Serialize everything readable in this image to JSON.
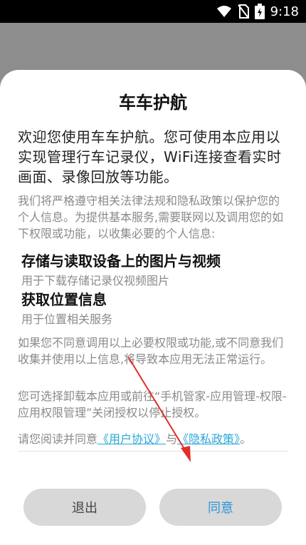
{
  "status_bar": {
    "time": "9:18",
    "icons": [
      "wifi-icon",
      "no-sim-icon",
      "battery-charging-icon"
    ]
  },
  "dialog": {
    "title": "车车护航",
    "intro": "欢迎您使用车车护航。您可使用本应用以实现管理行车记录仪，WiFi连接查看实时画面、录像回放等功能。",
    "notice": "我们将严格遵守相关法律法规和隐私政策以保护您的个人信息。为提供基本服务,需要联网以及调用您的如下权限或功能，以收集必要的个人信息:",
    "permissions": [
      {
        "title": "存储与读取设备上的图片与视频",
        "desc": "用于下载存储记录仪视频图片"
      },
      {
        "title": "获取位置信息",
        "desc": "用于位置相关服务"
      }
    ],
    "disagree_text": "如果您不同意调用以上必要权限或功能,或不同意我们收集并使用以上信息,将导致本应用无法正常运行。",
    "revoke_text": "您可选择卸载本应用或前往“手机管家-应用管理-权限-应用权限管理”关闭授权以停止授权。",
    "agreement": {
      "prefix": "请您阅读并同意",
      "user_agreement_link": "《用户协议》",
      "and": "与",
      "privacy_policy_link": "《隐私政策》",
      "suffix": "。"
    },
    "buttons": {
      "exit_label": "退出",
      "agree_label": "同意"
    }
  },
  "colors": {
    "accent": "#2aa7d8",
    "arrow": "#e0302a",
    "backdrop": "#8d8d8d"
  }
}
